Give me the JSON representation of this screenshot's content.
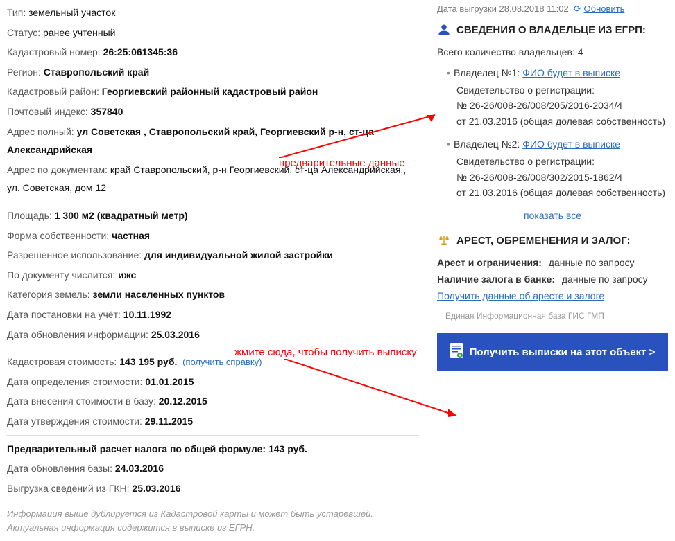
{
  "left": {
    "type_lbl": "Тип:",
    "type_val": "земельный участок",
    "status_lbl": "Статус:",
    "status_val": "ранее учтенный",
    "kad_num_lbl": "Кадастровый номер:",
    "kad_num_val": "26:25:061345:36",
    "region_lbl": "Регион:",
    "region_val": "Ставропольский край",
    "kad_rayon_lbl": "Кадастровый район:",
    "kad_rayon_val": "Георгиевский районный кадастровый район",
    "zip_lbl": "Почтовый индекс:",
    "zip_val": "357840",
    "addr_full_lbl": "Адрес полный:",
    "addr_full_val": "ул Советская , Ставропольский край, Георгиевский р-н, ст-ца Александрийская",
    "addr_doc_lbl": "Адрес по документам:",
    "addr_doc_val": "край Ставропольский, р-н Георгиевский, ст-ца Александрийская,, ул. Советская, дом 12",
    "area_lbl": "Площадь:",
    "area_val": "1 300 м2 (квадратный метр)",
    "form_lbl": "Форма собственности:",
    "form_val": "частная",
    "use_lbl": "Разрешенное использование:",
    "use_val": "для индивидуальной жилой застройки",
    "doc_lbl": "По документу числится:",
    "doc_val": "ижс",
    "cat_lbl": "Категория земель:",
    "cat_val": "земли населенных пунктов",
    "date_reg_lbl": "Дата постановки на учёт:",
    "date_reg_val": "10.11.1992",
    "date_upd_lbl": "Дата обновления информации:",
    "date_upd_val": "25.03.2016",
    "cost_lbl": "Кадастровая стоимость:",
    "cost_val": "143 195 руб.",
    "cost_link": "(получить справку)",
    "cost_date_lbl": "Дата определения стоимости:",
    "cost_date_val": "01.01.2015",
    "cost_in_lbl": "Дата внесения стоимости в базу:",
    "cost_in_val": "20.12.2015",
    "cost_appr_lbl": "Дата утверждения стоимости:",
    "cost_appr_val": "29.11.2015",
    "tax_lbl": "Предварительный расчет налога по общей формуле:",
    "tax_val": "143 руб.",
    "db_upd_lbl": "Дата обновления базы:",
    "db_upd_val": "24.03.2016",
    "gkn_lbl": "Выгрузка сведений из ГКН:",
    "gkn_val": "25.03.2016",
    "note": "Информация выше дублируется из Кадастровой карты и может быть устаревшей. Актуальная информация содержится в выписке из ЕГРН."
  },
  "right": {
    "dump_lbl": "Дата выгрузки",
    "dump_val": "28.08.2018 11:02",
    "refresh": "Обновить",
    "owners_title": "СВЕДЕНИЯ О ВЛАДЕЛЬЦЕ ИЗ ЕГРП:",
    "owners_total_lbl": "Всего количество владельцев:",
    "owners_total_val": "4",
    "owners": [
      {
        "label": "Владелец №1:",
        "fio": "ФИО будет в выписке",
        "reg_lbl": "Свидетельство о регистрации:",
        "reg_num": "№ 26-26/008-26/008/205/2016-2034/4",
        "reg_date": "от 21.03.2016 (общая долевая собственность)"
      },
      {
        "label": "Владелец №2:",
        "fio": "ФИО будет в выписке",
        "reg_lbl": "Свидетельство о регистрации:",
        "reg_num": "№ 26-26/008-26/008/302/2015-1862/4",
        "reg_date": "от 21.03.2016 (общая долевая собственность)"
      }
    ],
    "show_all": "показать все",
    "arrest_title": "АРЕСТ, ОБРЕМЕНЕНИЯ И ЗАЛОГ:",
    "arrest_lbl": "Арест и ограничения:",
    "arrest_val": "данные по запросу",
    "zalog_lbl": "Наличие залога в банке:",
    "zalog_val": "данные по запросу",
    "get_arrest": "Получить данные об аресте и залоге",
    "gis": "Единая Информационная база ГИС ГМП",
    "btn": "Получить выписки на этот объект >"
  },
  "red": {
    "note1": "предварительные данные",
    "note2": "жмите сюда, чтобы получить выписку"
  }
}
